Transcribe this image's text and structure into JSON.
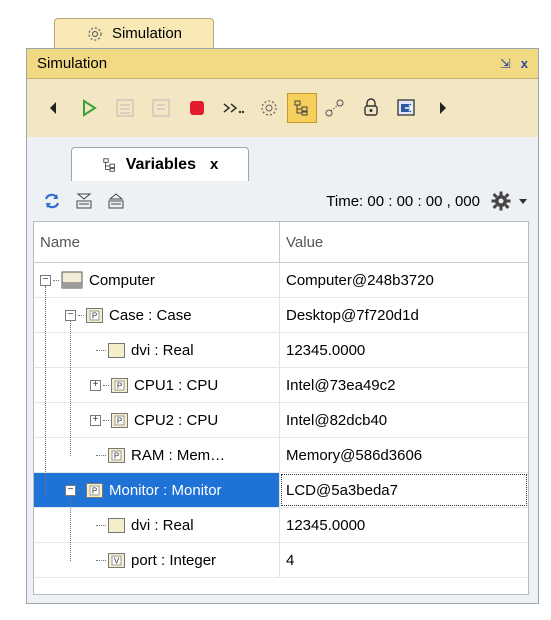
{
  "outer_tab": {
    "label": "Simulation"
  },
  "panel": {
    "title": "Simulation",
    "restore_label": "⇲",
    "close_label": "x"
  },
  "toolbar": {
    "buttons": [
      {
        "name": "step-back-icon"
      },
      {
        "name": "run-icon"
      },
      {
        "name": "step-into-icon"
      },
      {
        "name": "step-over-icon"
      },
      {
        "name": "terminate-icon"
      },
      {
        "name": "step-out-icon"
      },
      {
        "name": "breakpoint-icon"
      },
      {
        "name": "variables-icon",
        "selected": true
      },
      {
        "name": "breakpoints-view-icon"
      },
      {
        "name": "lock-icon"
      },
      {
        "name": "export-icon"
      },
      {
        "name": "step-forward-icon"
      }
    ]
  },
  "variables_tab": {
    "label": "Variables",
    "close_label": "x"
  },
  "time": {
    "label": "Time:",
    "value": "00 : 00 : 00 , 000"
  },
  "table": {
    "columns": [
      "Name",
      "Value"
    ],
    "rows": [
      {
        "name": "Computer",
        "value": "Computer@248b3720",
        "level": 0,
        "expander": "minus",
        "icon": "class",
        "selected": false
      },
      {
        "name": "Case : Case",
        "value": "Desktop@7f720d1d",
        "level": 1,
        "expander": "minus",
        "icon": "P",
        "selected": false
      },
      {
        "name": "dvi : Real",
        "value": "12345.0000",
        "level": 2,
        "expander": "none",
        "icon": "blank",
        "selected": false
      },
      {
        "name": "CPU1 : CPU",
        "value": "Intel@73ea49c2",
        "level": 2,
        "expander": "plus",
        "icon": "P",
        "selected": false
      },
      {
        "name": "CPU2 : CPU",
        "value": "Intel@82dcb40",
        "level": 2,
        "expander": "plus",
        "icon": "P",
        "selected": false
      },
      {
        "name": "RAM : Mem…",
        "value": "Memory@586d3606",
        "level": 2,
        "expander": "none",
        "icon": "P",
        "selected": false
      },
      {
        "name": "Monitor : Monitor",
        "value": "LCD@5a3beda7",
        "level": 1,
        "expander": "minus",
        "icon": "P",
        "selected": true
      },
      {
        "name": "dvi : Real",
        "value": "12345.0000",
        "level": 2,
        "expander": "none",
        "icon": "blank",
        "selected": false
      },
      {
        "name": "port : Integer",
        "value": "4",
        "level": 2,
        "expander": "none",
        "icon": "V",
        "selected": false
      }
    ]
  },
  "colors": {
    "accent_title": "#f2d984",
    "selection": "#1f73d6",
    "toolbar_bg": "#f3e6c3"
  }
}
